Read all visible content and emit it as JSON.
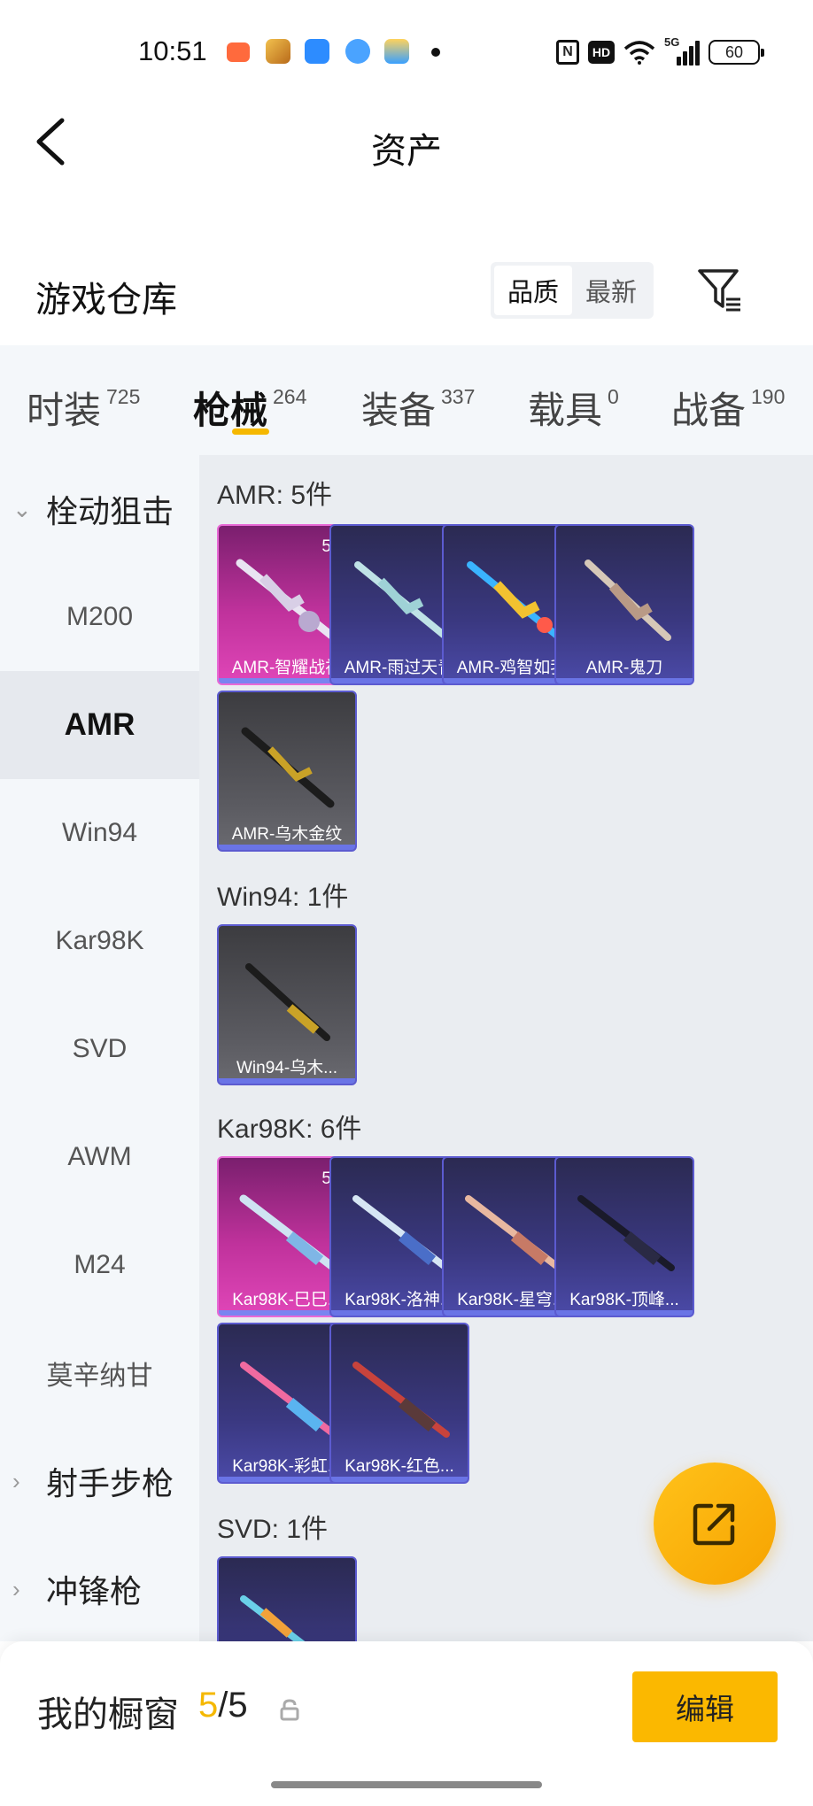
{
  "status_bar": {
    "time": "10:51",
    "battery": "60",
    "network": "5G"
  },
  "header": {
    "title": "资产"
  },
  "warehouse": {
    "title": "游戏仓库",
    "sort_options": [
      "品质",
      "最新"
    ],
    "sort_selected": "品质"
  },
  "tabs": [
    {
      "label": "时装",
      "count": "725"
    },
    {
      "label": "枪械",
      "count": "264",
      "active": true
    },
    {
      "label": "装备",
      "count": "337"
    },
    {
      "label": "载具",
      "count": "0"
    },
    {
      "label": "战备",
      "count": "190"
    }
  ],
  "sidebar": {
    "group_open": "栓动狙击",
    "items": [
      "M200",
      "AMR",
      "Win94",
      "Kar98K",
      "SVD",
      "AWM",
      "M24",
      "莫辛纳甘"
    ],
    "active_item": "AMR",
    "groups_collapsed": [
      "射手步枪",
      "冲锋枪"
    ]
  },
  "sections": [
    {
      "title": "AMR: 5件",
      "items": [
        {
          "name": "AMR-智耀战神",
          "level": "5级",
          "rarity": "pink"
        },
        {
          "name": "AMR-雨过天青",
          "rarity": "purple"
        },
        {
          "name": "AMR-鸡智如我",
          "rarity": "purple"
        },
        {
          "name": "AMR-鬼刀",
          "rarity": "purple"
        },
        {
          "name": "AMR-乌木金纹",
          "rarity": "gray"
        }
      ]
    },
    {
      "title": "Win94: 1件",
      "items": [
        {
          "name": "Win94-乌木...",
          "rarity": "gray"
        }
      ]
    },
    {
      "title": "Kar98K: 6件",
      "items": [
        {
          "name": "Kar98K-巳巳...",
          "level": "5级",
          "rarity": "pink"
        },
        {
          "name": "Kar98K-洛神...",
          "rarity": "purple"
        },
        {
          "name": "Kar98K-星穹...",
          "rarity": "purple"
        },
        {
          "name": "Kar98K-顶峰...",
          "rarity": "purple"
        },
        {
          "name": "Kar98K-彩虹...",
          "rarity": "purple"
        },
        {
          "name": "Kar98K-红色...",
          "rarity": "purple"
        }
      ]
    },
    {
      "title": "SVD: 1件",
      "items": [
        {
          "name": "",
          "rarity": "purple"
        }
      ]
    }
  ],
  "bottom_bar": {
    "label": "我的橱窗",
    "count_current": "5",
    "count_sep": "/",
    "count_total": "5",
    "edit_label": "编辑"
  },
  "colors": {
    "accent": "#f5b800",
    "pink_rarity": "#c0329c",
    "purple_rarity": "#3a3880"
  }
}
